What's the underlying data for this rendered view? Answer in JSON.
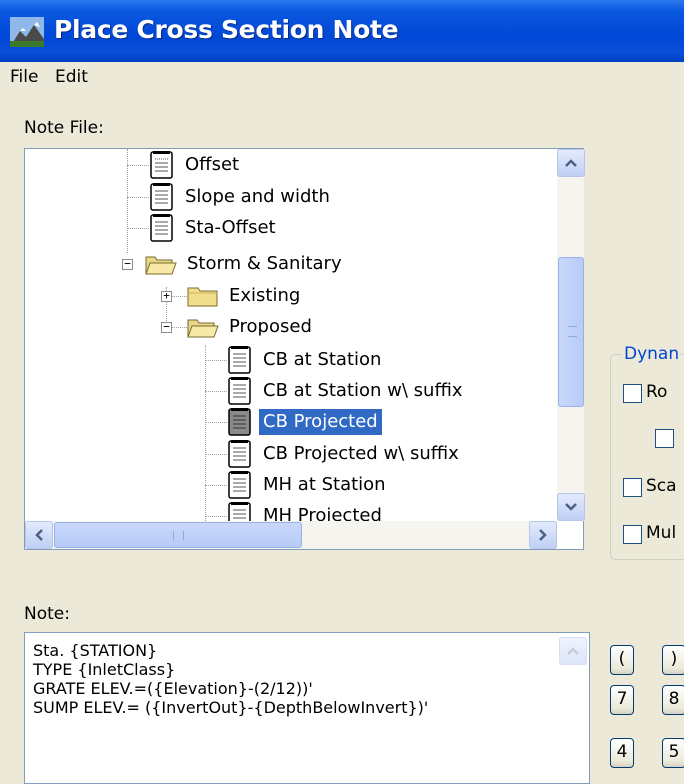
{
  "window": {
    "title": "Place Cross Section Note"
  },
  "menu": [
    "File",
    "Edit"
  ],
  "note_file": {
    "label": "Note File:",
    "tree": [
      {
        "label": "Offset",
        "icon": "document-icon"
      },
      {
        "label": "Slope and width",
        "icon": "document-icon"
      },
      {
        "label": "Sta-Offset",
        "icon": "document-icon"
      },
      {
        "label": "Storm & Sanitary",
        "icon": "folder-open-icon",
        "expander": "−"
      },
      {
        "label": "Existing",
        "icon": "folder-icon",
        "expander": "+"
      },
      {
        "label": "Proposed",
        "icon": "folder-open-icon",
        "expander": "−"
      },
      {
        "label": "CB at Station",
        "icon": "document-icon"
      },
      {
        "label": "CB at Station w\\ suffix",
        "icon": "document-icon"
      },
      {
        "label": "CB Projected",
        "icon": "document-icon",
        "selected": true
      },
      {
        "label": "CB Projected w\\ suffix",
        "icon": "document-icon"
      },
      {
        "label": "MH at Station",
        "icon": "document-icon"
      },
      {
        "label": "MH Projected",
        "icon": "document-icon"
      }
    ]
  },
  "dynamic": {
    "title": "Dynan",
    "options": [
      {
        "label": "Ro",
        "checked": false
      },
      {
        "label": "",
        "checked": false
      },
      {
        "label": "Sca",
        "checked": false
      },
      {
        "label": "Mul",
        "checked": false
      }
    ]
  },
  "note": {
    "label": "Note:",
    "lines": [
      "Sta. {STATION}",
      "TYPE {InletClass}",
      "GRATE ELEV.=({Elevation}-(2/12))'",
      "SUMP ELEV.= ({InvertOut}-{DepthBelowInvert})'"
    ]
  },
  "keypad": [
    "(",
    ")",
    "7",
    "8",
    "4",
    "5"
  ]
}
